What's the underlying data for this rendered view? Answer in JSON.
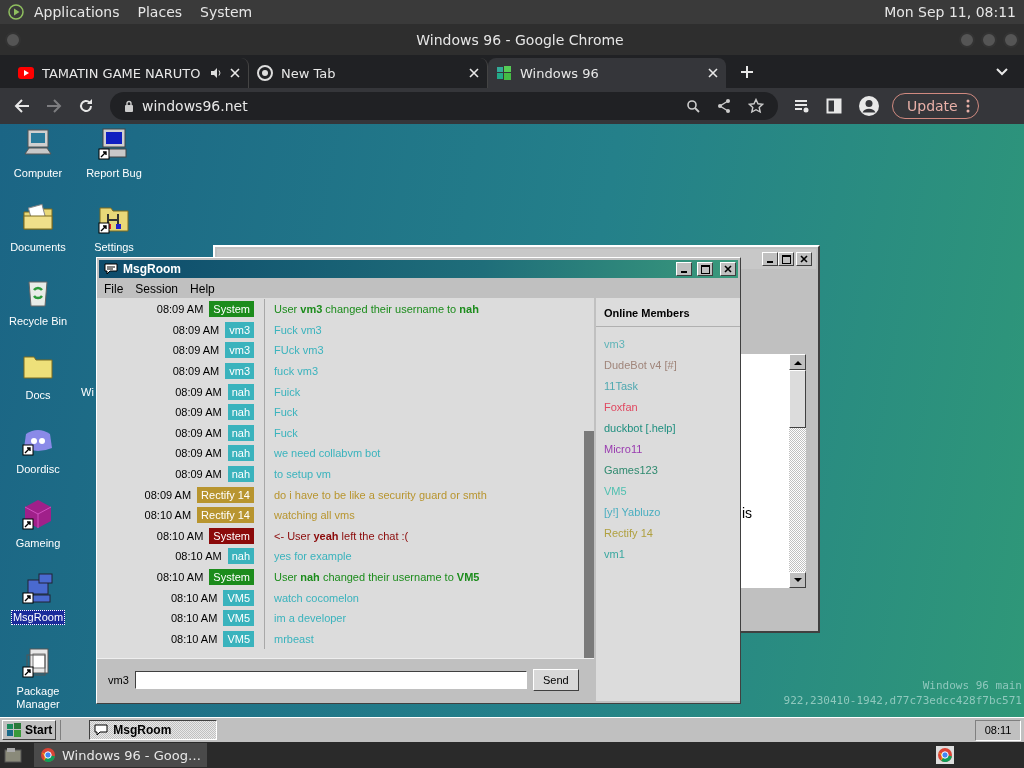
{
  "top_panel": {
    "menus": [
      "Applications",
      "Places",
      "System"
    ],
    "clock": "Mon Sep 11, 08:11"
  },
  "browser": {
    "title": "Windows 96 - Google Chrome",
    "tabs": [
      {
        "label": "TAMATIN GAME NARUTO",
        "kind": "video",
        "audio": true,
        "selected": false
      },
      {
        "label": "New Tab",
        "kind": "newtab",
        "audio": false,
        "selected": false
      },
      {
        "label": "Windows 96",
        "kind": "site",
        "audio": false,
        "selected": true
      }
    ],
    "forward_disabled": true,
    "url": "windows96.net",
    "update_button": "Update"
  },
  "desktop": {
    "icon_columns": [
      [
        {
          "label": "Computer",
          "kind": "computer",
          "shortcut": false,
          "selected": false
        },
        {
          "label": "Documents",
          "kind": "documents",
          "shortcut": false,
          "selected": false
        },
        {
          "label": "Recycle Bin",
          "kind": "recycle",
          "shortcut": false,
          "selected": false
        },
        {
          "label": "Docs",
          "kind": "folder",
          "shortcut": false,
          "selected": false
        },
        {
          "label": "Doordisc",
          "kind": "blob",
          "shortcut": true,
          "selected": false
        },
        {
          "label": "Gameing",
          "kind": "cube",
          "shortcut": true,
          "selected": false
        },
        {
          "label": "MsgRoom",
          "kind": "msgroom",
          "shortcut": true,
          "selected": true
        },
        {
          "label": "Package Manager",
          "kind": "package",
          "shortcut": true,
          "selected": false
        }
      ],
      [
        {
          "label": "Report Bug",
          "kind": "monitor",
          "shortcut": true,
          "selected": false
        },
        {
          "label": "Settings",
          "kind": "settings",
          "shortcut": true,
          "selected": false
        }
      ]
    ],
    "partial_label": "Wi",
    "build_info": [
      "Windows 96 main",
      "922,230410-1942,d77c73edcc428f7bc571"
    ]
  },
  "background_window": {
    "text": "is"
  },
  "msgroom": {
    "title": "MsgRoom",
    "menu": [
      "File",
      "Session",
      "Help"
    ],
    "messages": [
      {
        "time": "08:09 AM",
        "user": "System",
        "color": "#1c8c1c",
        "text": "User **vm3** changed their username to **nah**"
      },
      {
        "time": "08:09 AM",
        "user": "vm3",
        "color": "#3ab3bd",
        "text": "Fuck vm3"
      },
      {
        "time": "08:09 AM",
        "user": "vm3",
        "color": "#3ab3bd",
        "text": "FUck vm3"
      },
      {
        "time": "08:09 AM",
        "user": "vm3",
        "color": "#3ab3bd",
        "text": "fuck vm3"
      },
      {
        "time": "08:09 AM",
        "user": "nah",
        "color": "#3ab3bd",
        "text": "Fuick"
      },
      {
        "time": "08:09 AM",
        "user": "nah",
        "color": "#3ab3bd",
        "text": "Fuck"
      },
      {
        "time": "08:09 AM",
        "user": "nah",
        "color": "#3ab3bd",
        "text": "Fuck"
      },
      {
        "time": "08:09 AM",
        "user": "nah",
        "color": "#3ab3bd",
        "text": "we need collabvm bot"
      },
      {
        "time": "08:09 AM",
        "user": "nah",
        "color": "#3ab3bd",
        "text": "to setup vm"
      },
      {
        "time": "08:09 AM",
        "user": "Rectify 14",
        "color": "#b8952f",
        "text": "do i have to be like a security guard or smth"
      },
      {
        "time": "08:10 AM",
        "user": "Rectify 14",
        "color": "#b8952f",
        "text": "watching all vms"
      },
      {
        "time": "08:10 AM",
        "user": "System",
        "color": "#8b0a0a",
        "text": "<- User **yeah** left the chat :("
      },
      {
        "time": "08:10 AM",
        "user": "nah",
        "color": "#3ab3bd",
        "text": "yes for example"
      },
      {
        "time": "08:10 AM",
        "user": "System",
        "color": "#1c8c1c",
        "text": "User **nah** changed their username to **VM5**"
      },
      {
        "time": "08:10 AM",
        "user": "VM5",
        "color": "#3ab3bd",
        "text": "watch cocomelon"
      },
      {
        "time": "08:10 AM",
        "user": "VM5",
        "color": "#3ab3bd",
        "text": "im a developer"
      },
      {
        "time": "08:10 AM",
        "user": "VM5",
        "color": "#3ab3bd",
        "text": "mrbeast"
      }
    ],
    "members_title": "Online Members",
    "members": [
      {
        "name": "vm3",
        "color": "#5fb4b8"
      },
      {
        "name": "DudeBot v4 [#]",
        "color": "#a0857a"
      },
      {
        "name": "11Task",
        "color": "#4fa8b0"
      },
      {
        "name": "Foxfan",
        "color": "#e04860"
      },
      {
        "name": "duckbot [.help]",
        "color": "#1f8f7f"
      },
      {
        "name": "Micro11",
        "color": "#9a3cb0"
      },
      {
        "name": "Games123",
        "color": "#2f8a6f"
      },
      {
        "name": "VM5",
        "color": "#4fc0b0"
      },
      {
        "name": "[y!] Yabluzo",
        "color": "#4aaec0"
      },
      {
        "name": "Rectify 14",
        "color": "#b0a040"
      },
      {
        "name": "vm1",
        "color": "#3aa8a0"
      }
    ],
    "nick": "vm3",
    "send_button": "Send"
  },
  "taskbar": {
    "start": "Start",
    "tasks": [
      {
        "label": "MsgRoom",
        "selected": true
      }
    ],
    "clock": "08:11"
  },
  "os_panel": {
    "windows": [
      {
        "label": "Windows 96 - Goog…"
      }
    ]
  }
}
